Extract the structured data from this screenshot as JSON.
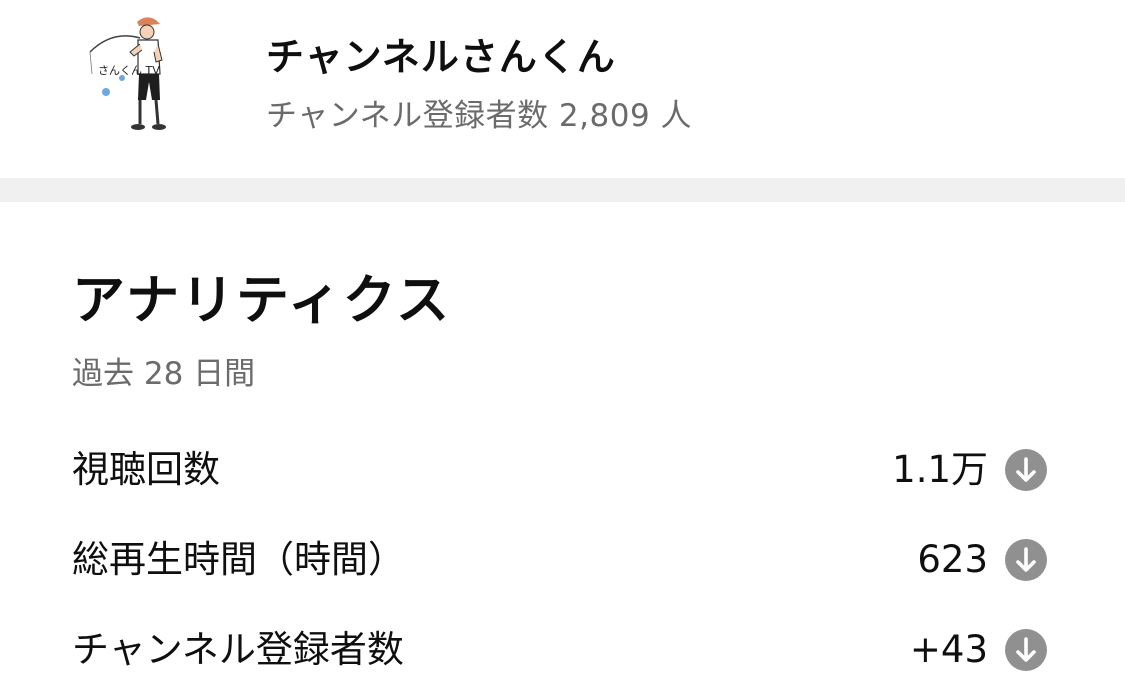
{
  "channel": {
    "name": "チャンネルさんくん",
    "subscriber_text": "チャンネル登録者数 2,809 人",
    "avatar_icon": "fisherman-avatar-icon",
    "avatar_text": "さんくん TV"
  },
  "analytics": {
    "title": "アナリティクス",
    "period": "過去 28 日間",
    "metrics": [
      {
        "label": "視聴回数",
        "value": "1.1万",
        "trend_icon": "arrow-down-circle-icon"
      },
      {
        "label": "総再生時間（時間）",
        "value": "623",
        "trend_icon": "arrow-down-circle-icon"
      },
      {
        "label": "チャンネル登録者数",
        "value": "+43",
        "trend_icon": "arrow-down-circle-icon"
      }
    ]
  },
  "colors": {
    "primary_text": "#0f0f0f",
    "secondary_text": "#6b6b6b",
    "divider": "#f0f0f0",
    "trend_icon": "#909090"
  }
}
